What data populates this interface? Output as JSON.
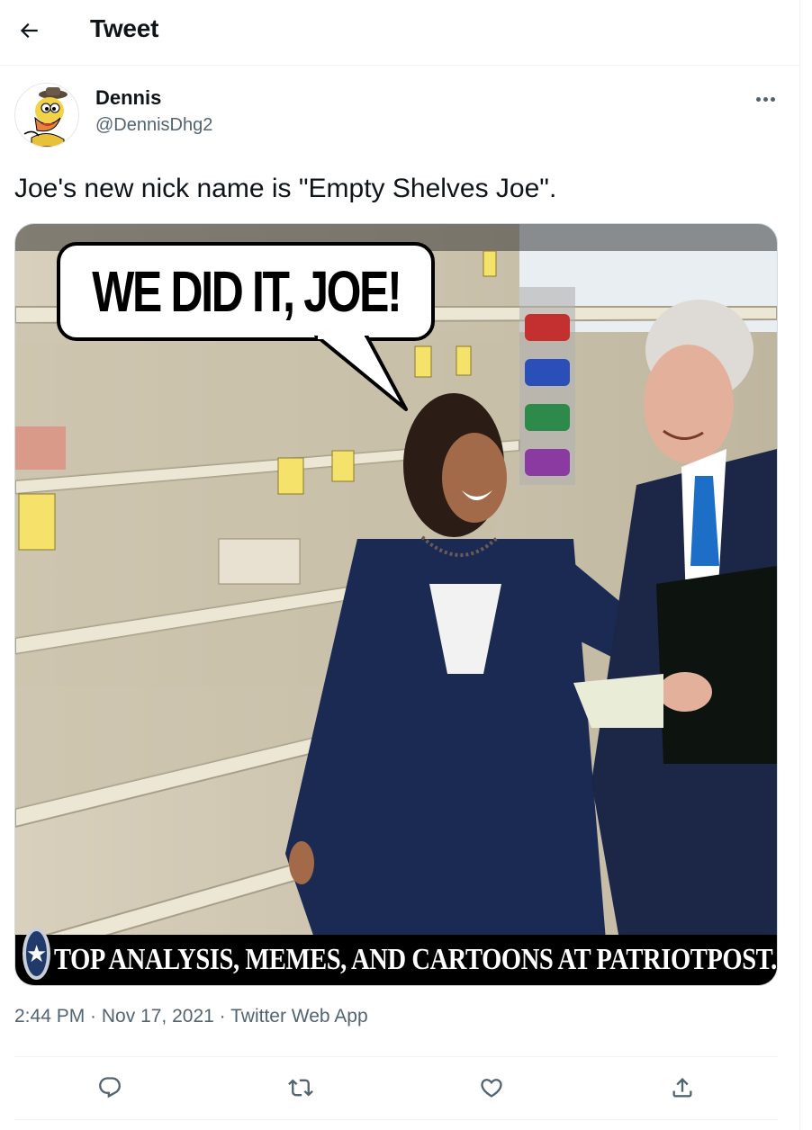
{
  "header": {
    "title": "Tweet",
    "back_icon": "arrow-left-icon"
  },
  "author": {
    "display_name": "Dennis",
    "handle": "@DennisDhg2",
    "avatar": "cartoon-duck-avatar"
  },
  "tweet": {
    "text": "Joe's new nick name is \"Empty Shelves Joe\"."
  },
  "media": {
    "speech_bubble": "WE DID IT, JOE!",
    "banner_text": "TOP ANALYSIS, MEMES, AND CARTOONS AT PATRIOTPOST.US",
    "logo_star": "★"
  },
  "meta": {
    "time": "2:44 PM",
    "separator": " · ",
    "date": "Nov 17, 2021",
    "source": "Twitter Web App"
  },
  "actions": [
    {
      "name": "reply",
      "icon": "reply-icon"
    },
    {
      "name": "retweet",
      "icon": "retweet-icon"
    },
    {
      "name": "like",
      "icon": "heart-icon"
    },
    {
      "name": "share",
      "icon": "share-icon"
    }
  ],
  "colors": {
    "text": "#0f1419",
    "secondary": "#536471",
    "border": "#eff3f4"
  }
}
